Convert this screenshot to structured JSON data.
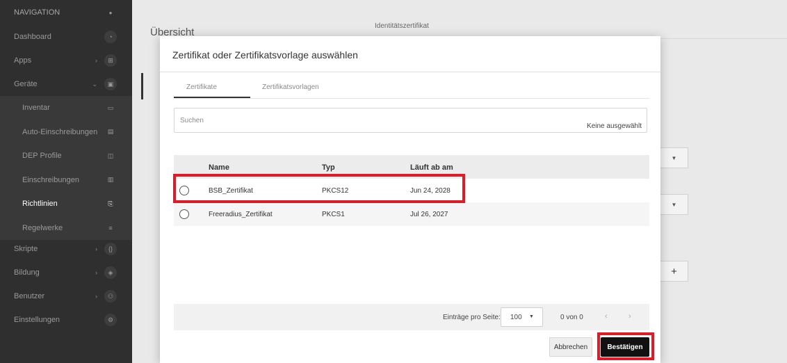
{
  "sidebar": {
    "heading": "NAVIGATION",
    "items": [
      {
        "label": "Dashboard",
        "icon": "gauge-icon"
      },
      {
        "label": "Apps",
        "icon": "grid-icon"
      },
      {
        "label": "Geräte",
        "icon": "devices-icon"
      },
      {
        "label": "Inventar",
        "icon": "inventory-icon"
      },
      {
        "label": "Auto-Einschreibungen",
        "icon": "auto-enroll-icon"
      },
      {
        "label": "DEP Profile",
        "icon": "dep-profile-icon"
      },
      {
        "label": "Einschreibungen",
        "icon": "enrollment-icon"
      },
      {
        "label": "Richtlinien",
        "icon": "policy-icon"
      },
      {
        "label": "Regelwerke",
        "icon": "ruleset-icon"
      },
      {
        "label": "Skripte",
        "icon": "code-icon"
      },
      {
        "label": "Bildung",
        "icon": "education-icon"
      },
      {
        "label": "Benutzer",
        "icon": "users-icon"
      },
      {
        "label": "Einstellungen",
        "icon": "gear-icon"
      }
    ]
  },
  "background": {
    "title": "Übersicht",
    "column_header": "Identitätszertifikat"
  },
  "modal": {
    "title": "Zertifikat oder Zertifikatsvorlage auswählen",
    "tabs": [
      "Zertifikate",
      "Zertifikatsvorlagen"
    ],
    "search": {
      "placeholder": "Suchen",
      "selection_hint": "Keine ausgewählt"
    },
    "table": {
      "headers": [
        "Name",
        "Typ",
        "Läuft ab am"
      ],
      "rows": [
        {
          "name": "BSB_Zertifikat",
          "type": "PKCS12",
          "expires": "Jun 24, 2028"
        },
        {
          "name": "Freeradius_Zertifikat",
          "type": "PKCS1",
          "expires": "Jul 26, 2027"
        }
      ]
    },
    "pagination": {
      "per_page_label": "Einträge pro Seite:",
      "per_page_value": "100",
      "count": "0 von 0"
    },
    "buttons": {
      "cancel": "Abbrechen",
      "confirm": "Bestätigen"
    }
  },
  "colors": {
    "sidebar_bg": "#2f2f2f",
    "highlight": "#e01b24",
    "confirm_bg": "#111111"
  }
}
